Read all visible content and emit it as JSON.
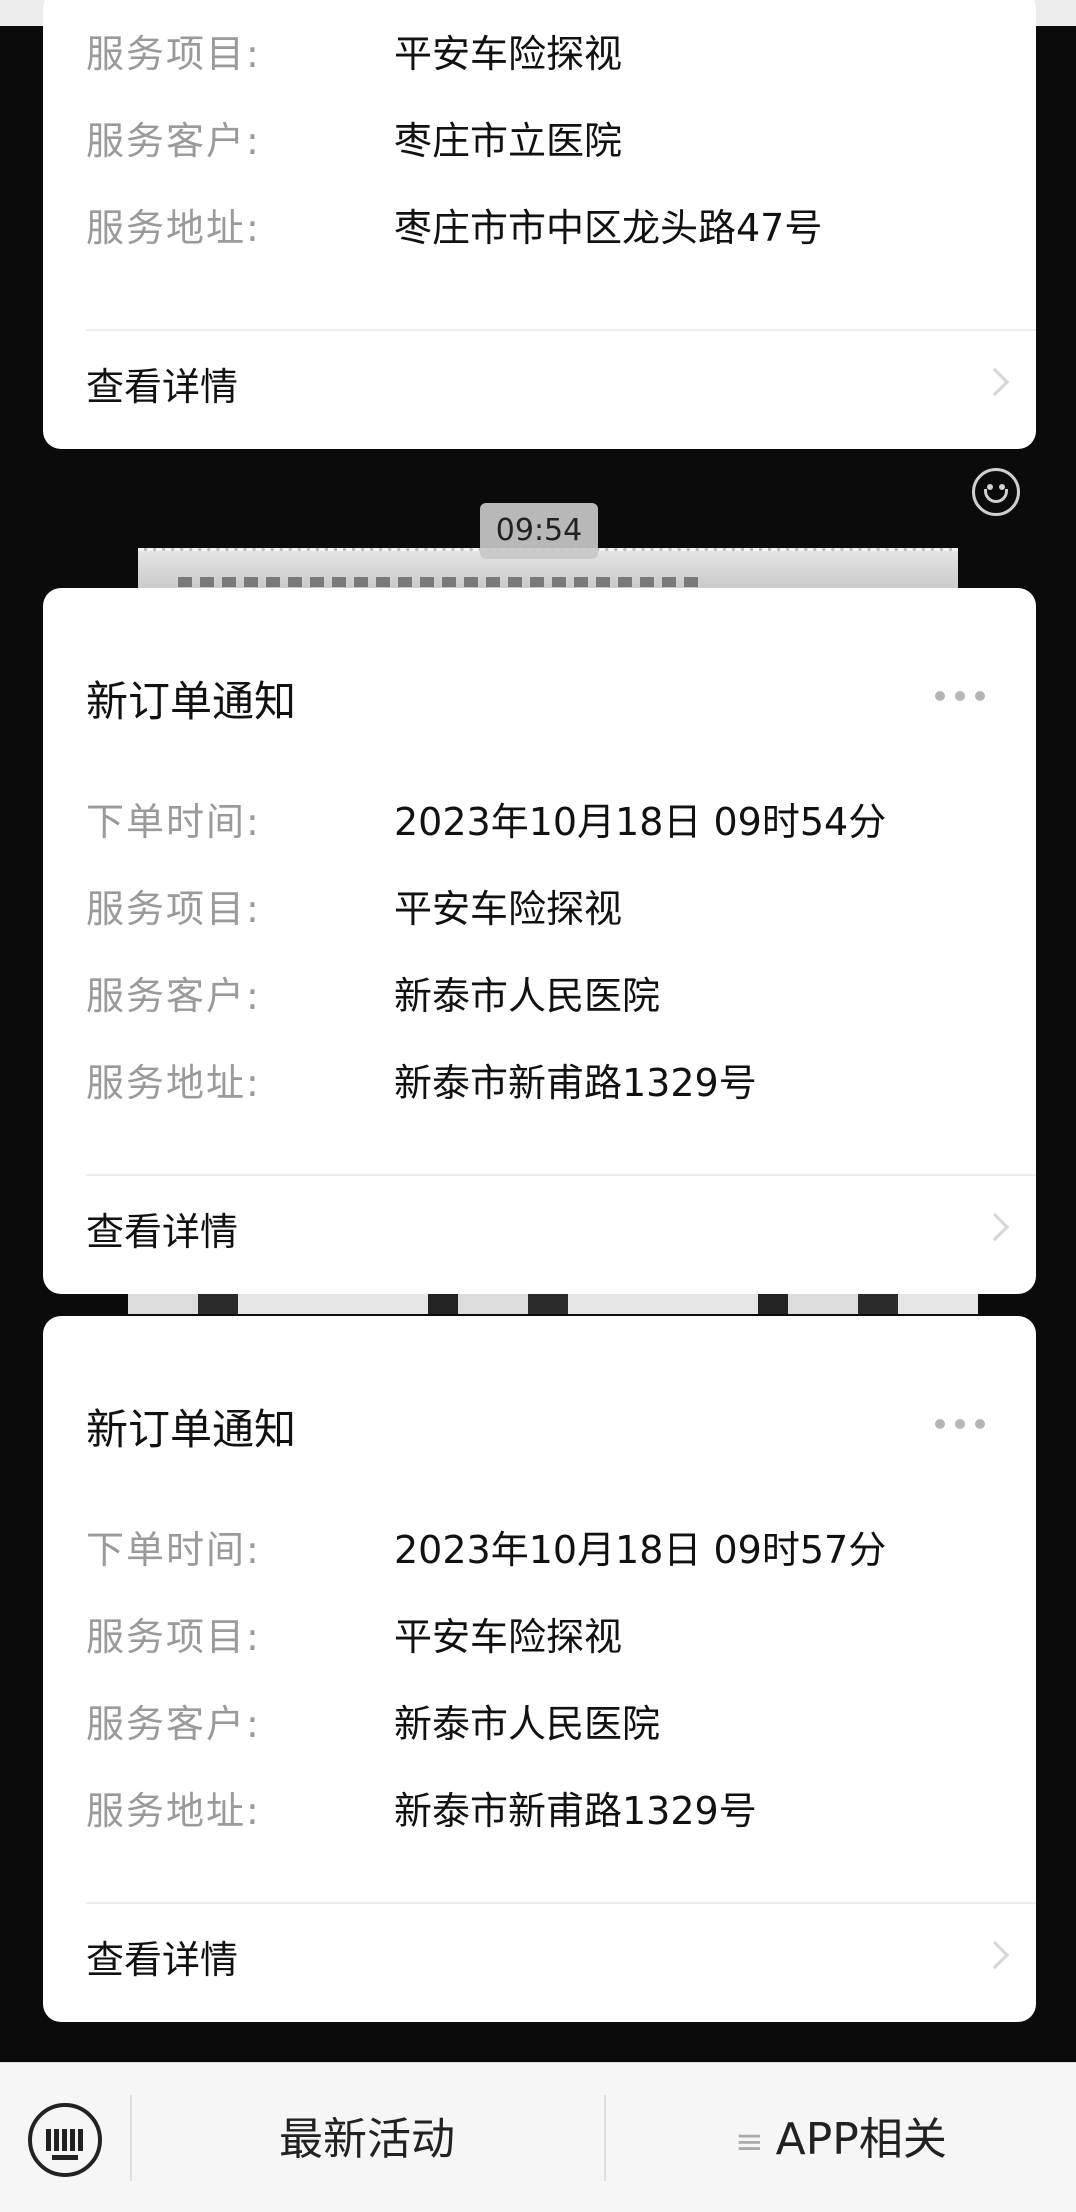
{
  "chat": {
    "timestamp": "09:54",
    "emoji_icon": "smiley-face-icon"
  },
  "cards": [
    {
      "title": "",
      "rows": [
        {
          "label": "服务项目:",
          "value": "平安车险探视"
        },
        {
          "label": "服务客户:",
          "value": "枣庄市立医院"
        },
        {
          "label": "服务地址:",
          "value": "枣庄市市中区龙头路47号"
        }
      ],
      "detail_label": "查看详情"
    },
    {
      "title": "新订单通知",
      "rows": [
        {
          "label": "下单时间:",
          "value": "2023年10月18日 09时54分"
        },
        {
          "label": "服务项目:",
          "value": "平安车险探视"
        },
        {
          "label": "服务客户:",
          "value": "新泰市人民医院"
        },
        {
          "label": "服务地址:",
          "value": "新泰市新甫路1329号"
        }
      ],
      "detail_label": "查看详情"
    },
    {
      "title": "新订单通知",
      "rows": [
        {
          "label": "下单时间:",
          "value": "2023年10月18日 09时57分"
        },
        {
          "label": "服务项目:",
          "value": "平安车险探视"
        },
        {
          "label": "服务客户:",
          "value": "新泰市人民医院"
        },
        {
          "label": "服务地址:",
          "value": "新泰市新甫路1329号"
        }
      ],
      "detail_label": "查看详情"
    }
  ],
  "bottom_menu": {
    "keyboard_icon": "keyboard-icon",
    "items": [
      {
        "label": "最新活动"
      },
      {
        "label": "APP相关",
        "prefix_icon": "menu-lines-icon"
      }
    ]
  }
}
